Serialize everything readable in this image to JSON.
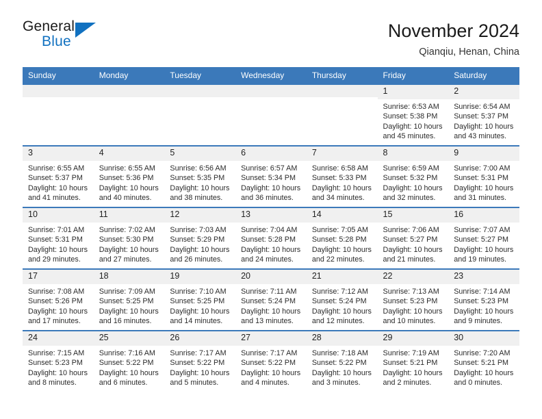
{
  "brand": {
    "name_part1": "General",
    "name_part2": "Blue",
    "accent_color": "#1171c0"
  },
  "header": {
    "title": "November 2024",
    "subtitle": "Qianqiu, Henan, China"
  },
  "theme": {
    "header_row_color": "#3b79ba",
    "day_band_color": "#f0f0f0",
    "text_color": "#222222"
  },
  "weekdays": [
    "Sunday",
    "Monday",
    "Tuesday",
    "Wednesday",
    "Thursday",
    "Friday",
    "Saturday"
  ],
  "labels": {
    "sunrise": "Sunrise:",
    "sunset": "Sunset:",
    "daylight": "Daylight:"
  },
  "weeks": [
    [
      {
        "day": "",
        "empty": true
      },
      {
        "day": "",
        "empty": true
      },
      {
        "day": "",
        "empty": true
      },
      {
        "day": "",
        "empty": true
      },
      {
        "day": "",
        "empty": true
      },
      {
        "day": "1",
        "sunrise": "Sunrise: 6:53 AM",
        "sunset": "Sunset: 5:38 PM",
        "daylight_line1": "Daylight: 10 hours",
        "daylight_line2": "and 45 minutes."
      },
      {
        "day": "2",
        "sunrise": "Sunrise: 6:54 AM",
        "sunset": "Sunset: 5:37 PM",
        "daylight_line1": "Daylight: 10 hours",
        "daylight_line2": "and 43 minutes."
      }
    ],
    [
      {
        "day": "3",
        "sunrise": "Sunrise: 6:55 AM",
        "sunset": "Sunset: 5:37 PM",
        "daylight_line1": "Daylight: 10 hours",
        "daylight_line2": "and 41 minutes."
      },
      {
        "day": "4",
        "sunrise": "Sunrise: 6:55 AM",
        "sunset": "Sunset: 5:36 PM",
        "daylight_line1": "Daylight: 10 hours",
        "daylight_line2": "and 40 minutes."
      },
      {
        "day": "5",
        "sunrise": "Sunrise: 6:56 AM",
        "sunset": "Sunset: 5:35 PM",
        "daylight_line1": "Daylight: 10 hours",
        "daylight_line2": "and 38 minutes."
      },
      {
        "day": "6",
        "sunrise": "Sunrise: 6:57 AM",
        "sunset": "Sunset: 5:34 PM",
        "daylight_line1": "Daylight: 10 hours",
        "daylight_line2": "and 36 minutes."
      },
      {
        "day": "7",
        "sunrise": "Sunrise: 6:58 AM",
        "sunset": "Sunset: 5:33 PM",
        "daylight_line1": "Daylight: 10 hours",
        "daylight_line2": "and 34 minutes."
      },
      {
        "day": "8",
        "sunrise": "Sunrise: 6:59 AM",
        "sunset": "Sunset: 5:32 PM",
        "daylight_line1": "Daylight: 10 hours",
        "daylight_line2": "and 32 minutes."
      },
      {
        "day": "9",
        "sunrise": "Sunrise: 7:00 AM",
        "sunset": "Sunset: 5:31 PM",
        "daylight_line1": "Daylight: 10 hours",
        "daylight_line2": "and 31 minutes."
      }
    ],
    [
      {
        "day": "10",
        "sunrise": "Sunrise: 7:01 AM",
        "sunset": "Sunset: 5:31 PM",
        "daylight_line1": "Daylight: 10 hours",
        "daylight_line2": "and 29 minutes."
      },
      {
        "day": "11",
        "sunrise": "Sunrise: 7:02 AM",
        "sunset": "Sunset: 5:30 PM",
        "daylight_line1": "Daylight: 10 hours",
        "daylight_line2": "and 27 minutes."
      },
      {
        "day": "12",
        "sunrise": "Sunrise: 7:03 AM",
        "sunset": "Sunset: 5:29 PM",
        "daylight_line1": "Daylight: 10 hours",
        "daylight_line2": "and 26 minutes."
      },
      {
        "day": "13",
        "sunrise": "Sunrise: 7:04 AM",
        "sunset": "Sunset: 5:28 PM",
        "daylight_line1": "Daylight: 10 hours",
        "daylight_line2": "and 24 minutes."
      },
      {
        "day": "14",
        "sunrise": "Sunrise: 7:05 AM",
        "sunset": "Sunset: 5:28 PM",
        "daylight_line1": "Daylight: 10 hours",
        "daylight_line2": "and 22 minutes."
      },
      {
        "day": "15",
        "sunrise": "Sunrise: 7:06 AM",
        "sunset": "Sunset: 5:27 PM",
        "daylight_line1": "Daylight: 10 hours",
        "daylight_line2": "and 21 minutes."
      },
      {
        "day": "16",
        "sunrise": "Sunrise: 7:07 AM",
        "sunset": "Sunset: 5:27 PM",
        "daylight_line1": "Daylight: 10 hours",
        "daylight_line2": "and 19 minutes."
      }
    ],
    [
      {
        "day": "17",
        "sunrise": "Sunrise: 7:08 AM",
        "sunset": "Sunset: 5:26 PM",
        "daylight_line1": "Daylight: 10 hours",
        "daylight_line2": "and 17 minutes."
      },
      {
        "day": "18",
        "sunrise": "Sunrise: 7:09 AM",
        "sunset": "Sunset: 5:25 PM",
        "daylight_line1": "Daylight: 10 hours",
        "daylight_line2": "and 16 minutes."
      },
      {
        "day": "19",
        "sunrise": "Sunrise: 7:10 AM",
        "sunset": "Sunset: 5:25 PM",
        "daylight_line1": "Daylight: 10 hours",
        "daylight_line2": "and 14 minutes."
      },
      {
        "day": "20",
        "sunrise": "Sunrise: 7:11 AM",
        "sunset": "Sunset: 5:24 PM",
        "daylight_line1": "Daylight: 10 hours",
        "daylight_line2": "and 13 minutes."
      },
      {
        "day": "21",
        "sunrise": "Sunrise: 7:12 AM",
        "sunset": "Sunset: 5:24 PM",
        "daylight_line1": "Daylight: 10 hours",
        "daylight_line2": "and 12 minutes."
      },
      {
        "day": "22",
        "sunrise": "Sunrise: 7:13 AM",
        "sunset": "Sunset: 5:23 PM",
        "daylight_line1": "Daylight: 10 hours",
        "daylight_line2": "and 10 minutes."
      },
      {
        "day": "23",
        "sunrise": "Sunrise: 7:14 AM",
        "sunset": "Sunset: 5:23 PM",
        "daylight_line1": "Daylight: 10 hours",
        "daylight_line2": "and 9 minutes."
      }
    ],
    [
      {
        "day": "24",
        "sunrise": "Sunrise: 7:15 AM",
        "sunset": "Sunset: 5:23 PM",
        "daylight_line1": "Daylight: 10 hours",
        "daylight_line2": "and 8 minutes."
      },
      {
        "day": "25",
        "sunrise": "Sunrise: 7:16 AM",
        "sunset": "Sunset: 5:22 PM",
        "daylight_line1": "Daylight: 10 hours",
        "daylight_line2": "and 6 minutes."
      },
      {
        "day": "26",
        "sunrise": "Sunrise: 7:17 AM",
        "sunset": "Sunset: 5:22 PM",
        "daylight_line1": "Daylight: 10 hours",
        "daylight_line2": "and 5 minutes."
      },
      {
        "day": "27",
        "sunrise": "Sunrise: 7:17 AM",
        "sunset": "Sunset: 5:22 PM",
        "daylight_line1": "Daylight: 10 hours",
        "daylight_line2": "and 4 minutes."
      },
      {
        "day": "28",
        "sunrise": "Sunrise: 7:18 AM",
        "sunset": "Sunset: 5:22 PM",
        "daylight_line1": "Daylight: 10 hours",
        "daylight_line2": "and 3 minutes."
      },
      {
        "day": "29",
        "sunrise": "Sunrise: 7:19 AM",
        "sunset": "Sunset: 5:21 PM",
        "daylight_line1": "Daylight: 10 hours",
        "daylight_line2": "and 2 minutes."
      },
      {
        "day": "30",
        "sunrise": "Sunrise: 7:20 AM",
        "sunset": "Sunset: 5:21 PM",
        "daylight_line1": "Daylight: 10 hours",
        "daylight_line2": "and 0 minutes."
      }
    ]
  ]
}
